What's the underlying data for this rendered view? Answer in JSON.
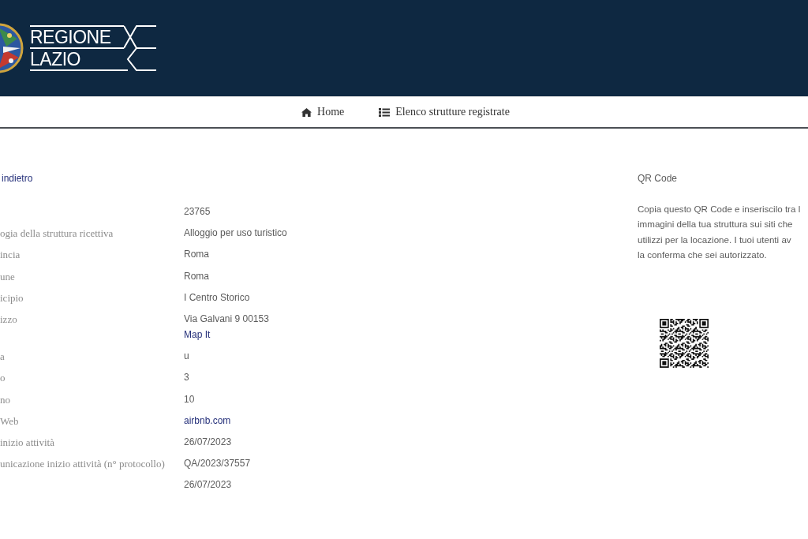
{
  "header": {
    "logo_lines": [
      "REGIONE",
      "LAZIO"
    ]
  },
  "nav": [
    {
      "label": "Home",
      "kind": "home"
    },
    {
      "label": "Elenco strutture registrate",
      "kind": "list"
    }
  ],
  "back_link": "indietro",
  "details": [
    {
      "value": "23765",
      "kind": "text"
    },
    {
      "label": "ogia della struttura ricettiva",
      "value": "Alloggio per uso turistico",
      "kind": "text"
    },
    {
      "label": "incia",
      "value": "Roma",
      "kind": "text"
    },
    {
      "label": "une",
      "value": "Roma",
      "kind": "text"
    },
    {
      "label": "icipio",
      "value": "I Centro Storico",
      "kind": "text"
    },
    {
      "label": "izzo",
      "value": "Via Galvani 9 00153",
      "kind": "address",
      "link": "Map It"
    },
    {
      "label": "a",
      "value": "u",
      "kind": "text"
    },
    {
      "label": "o",
      "value": "3",
      "kind": "text"
    },
    {
      "label": "no",
      "value": "10",
      "kind": "text"
    },
    {
      "label": "Web",
      "value": "airbnb.com",
      "kind": "link"
    },
    {
      "label": "inizio attività",
      "value": "26/07/2023",
      "kind": "text"
    },
    {
      "label": "unicazione inizio attività (n° protocollo)",
      "value": "QA/2023/37557",
      "kind": "text"
    },
    {
      "value": "26/07/2023",
      "kind": "text"
    }
  ],
  "qr_panel": {
    "title": "QR Code",
    "description_lines": [
      "Copia questo QR Code e inseriscilo tra l",
      "immagini della tua struttura sui siti che",
      "utilizzi per la locazione. I tuoi utenti av",
      "la conferma che sei autorizzato."
    ]
  }
}
